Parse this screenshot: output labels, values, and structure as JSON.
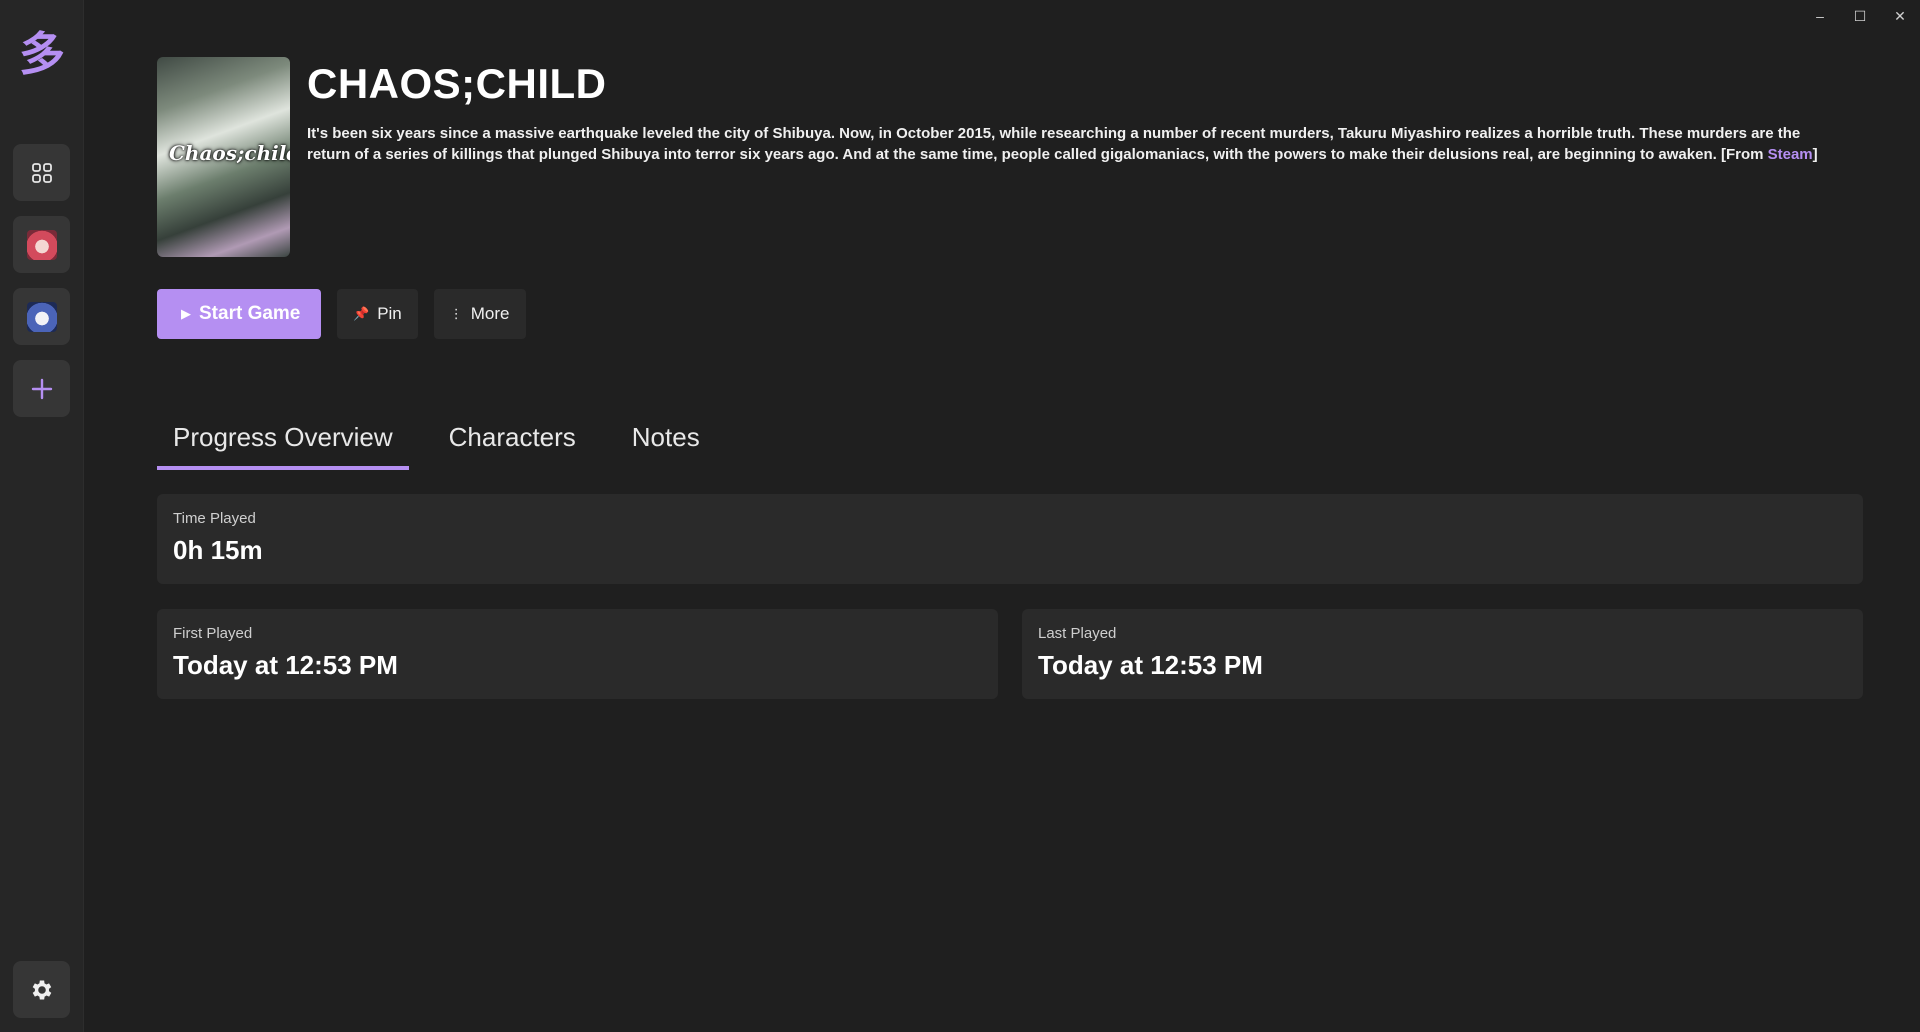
{
  "app": {
    "logo_glyph": "多",
    "accent_color": "#b58ff2"
  },
  "window_controls": {
    "minimize": "–",
    "maximize": "☐",
    "close": "✕"
  },
  "sidebar": {
    "items": [
      {
        "name": "library-grid",
        "icon": "grid-icon"
      },
      {
        "name": "game-avatar-1",
        "icon": "avatar-pink-hair"
      },
      {
        "name": "game-avatar-2",
        "icon": "avatar-blue-hair"
      },
      {
        "name": "add-game",
        "icon": "plus-icon"
      }
    ],
    "settings_icon": "gear-icon"
  },
  "game": {
    "title": "CHAOS;CHILD",
    "cover_text": "Chaos;child",
    "description": "It's been six years since a massive earthquake leveled the city of Shibuya. Now, in October 2015, while researching a number of recent murders, Takuru Miyashiro realizes a horrible truth. These murders are the return of a series of killings that plunged Shibuya into terror six years ago. And at the same time, people called gigalomaniacs, with the powers to make their delusions real, are beginning to awaken. [From ",
    "description_link": "Steam",
    "description_end": "]"
  },
  "actions": {
    "start_label": "Start Game",
    "pin_label": "Pin",
    "more_label": "More"
  },
  "tabs": [
    {
      "label": "Progress Overview"
    },
    {
      "label": "Characters"
    },
    {
      "label": "Notes"
    }
  ],
  "stats": {
    "time_played": {
      "label": "Time Played",
      "value": "0h 15m"
    },
    "first_played": {
      "label": "First Played",
      "value": "Today at 12:53 PM"
    },
    "last_played": {
      "label": "Last Played",
      "value": "Today at 12:53 PM"
    }
  }
}
